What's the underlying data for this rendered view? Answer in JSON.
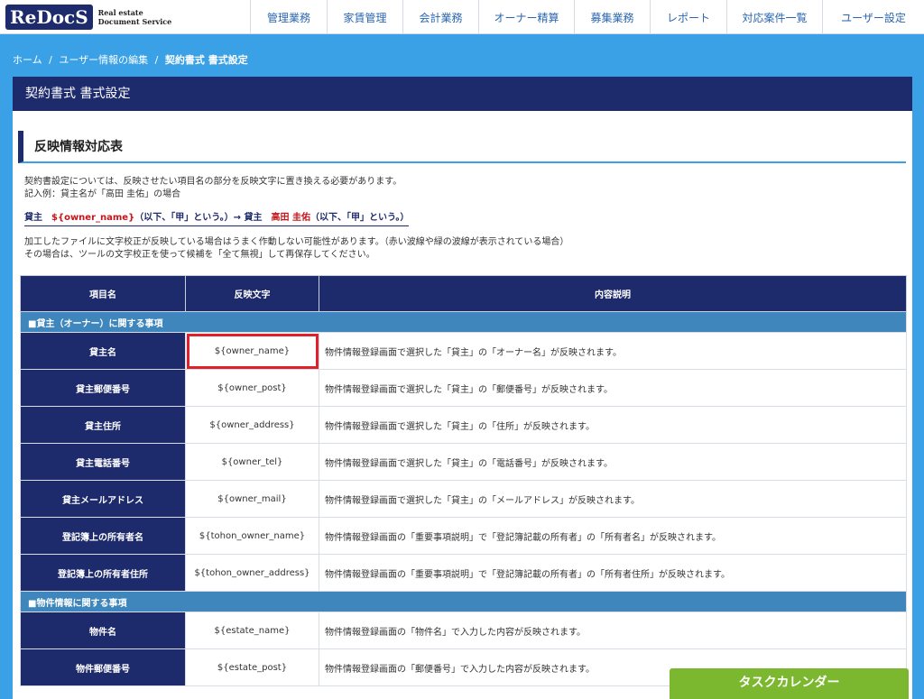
{
  "logo": {
    "brand": "ReDocS",
    "line1": "Real estate",
    "line2": "Document Service"
  },
  "nav": [
    "管理業務",
    "家賃管理",
    "会計業務",
    "オーナー精算",
    "募集業務",
    "レポート",
    "対応案件一覧",
    "ユーザー設定"
  ],
  "breadcrumb": [
    "ホーム",
    "/",
    "ユーザー情報の編集",
    "/",
    "契約書式 書式設定"
  ],
  "page_title": "契約書式 書式設定",
  "section_title": "反映情報対応表",
  "desc_line1": "契約書設定については、反映させたい項目名の部分を反映文字に置き換える必要があります。",
  "desc_line2": "記入例：貸主名が「高田 圭佑」の場合",
  "example": {
    "part1": "貸主　",
    "code": "${owner_name}",
    "part2": "（以下、「甲」という。）→ 貸主　",
    "name": "高田 圭佑",
    "part3": "（以下、「甲」という。）"
  },
  "note_line1": "加工したファイルに文字校正が反映している場合はうまく作動しない可能性があります。（赤い波線や緑の波線が表示されている場合）",
  "note_line2": "その場合は、ツールの文字校正を使って候補を「全て無視」して再保存してください。",
  "table": {
    "headers": [
      "項目名",
      "反映文字",
      "内容説明"
    ],
    "group1": "■貸主（オーナー）に関する事項",
    "group1_rows": [
      {
        "name": "貸主名",
        "code": "${owner_name}",
        "desc": "物件情報登録画面で選択した「貸主」の「オーナー名」が反映されます。"
      },
      {
        "name": "貸主郵便番号",
        "code": "${owner_post}",
        "desc": "物件情報登録画面で選択した「貸主」の「郵便番号」が反映されます。"
      },
      {
        "name": "貸主住所",
        "code": "${owner_address}",
        "desc": "物件情報登録画面で選択した「貸主」の「住所」が反映されます。"
      },
      {
        "name": "貸主電話番号",
        "code": "${owner_tel}",
        "desc": "物件情報登録画面で選択した「貸主」の「電話番号」が反映されます。"
      },
      {
        "name": "貸主メールアドレス",
        "code": "${owner_mail}",
        "desc": "物件情報登録画面で選択した「貸主」の「メールアドレス」が反映されます。"
      },
      {
        "name": "登記簿上の所有者名",
        "code": "${tohon_owner_name}",
        "desc": "物件情報登録画面の「重要事項説明」で「登記簿記載の所有者」の「所有者名」が反映されます。"
      },
      {
        "name": "登記簿上の所有者住所",
        "code": "${tohon_owner_address}",
        "desc": "物件情報登録画面の「重要事項説明」で「登記簿記載の所有者」の「所有者住所」が反映されます。"
      }
    ],
    "group2": "■物件情報に関する事項",
    "group2_rows": [
      {
        "name": "物件名",
        "code": "${estate_name}",
        "desc": "物件情報登録画面の「物件名」で入力した内容が反映されます。"
      },
      {
        "name": "物件郵便番号",
        "code": "${estate_post}",
        "desc": "物件情報登録画面の「郵便番号」で入力した内容が反映されます。"
      }
    ]
  },
  "task_calendar": "タスクカレンダー",
  "colors": {
    "navy": "#1d2a6b",
    "blue": "#3aa1e6",
    "group": "#3f86bd",
    "highlight": "#e0212b",
    "green": "#7cb82f"
  }
}
